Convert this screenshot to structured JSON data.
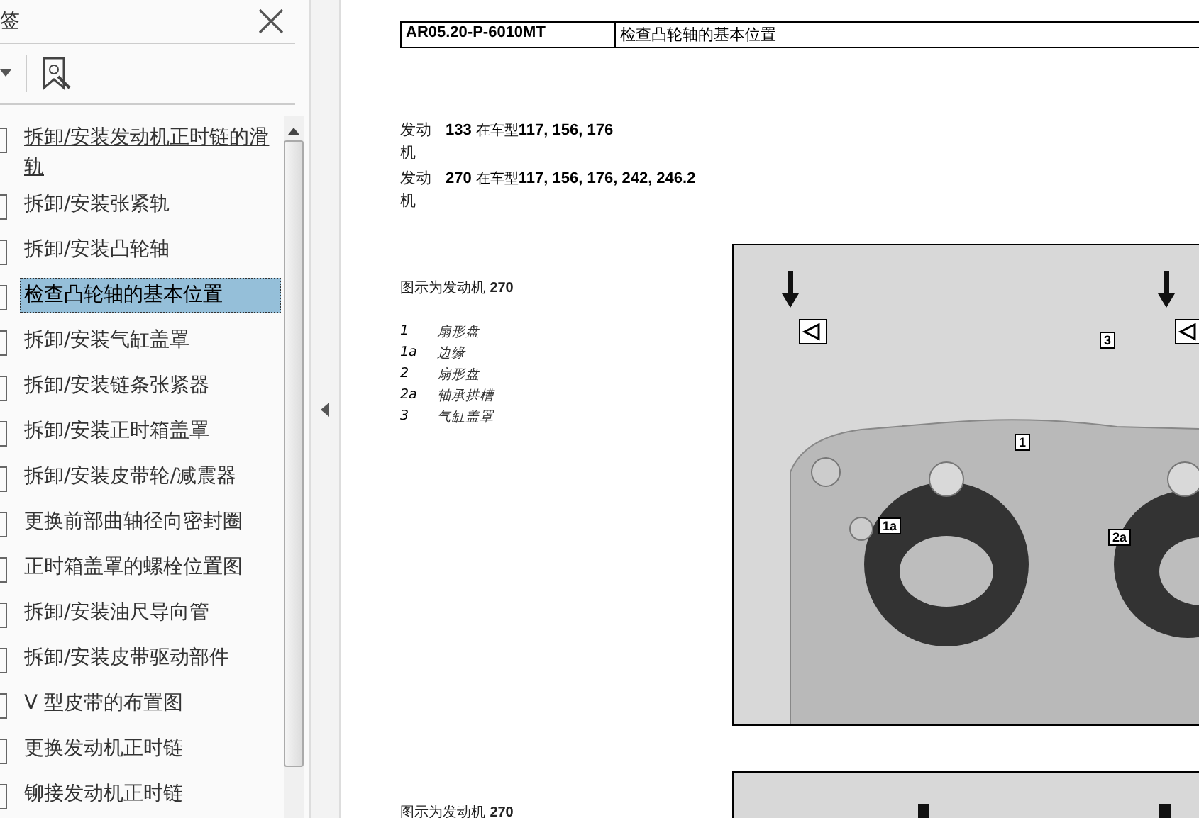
{
  "sidebar": {
    "title": "签",
    "items": [
      {
        "label": "拆卸/安装发动机正时链的滑轨",
        "selected": false,
        "hovered": true
      },
      {
        "label": "拆卸/安装张紧轨",
        "selected": false,
        "hovered": false
      },
      {
        "label": "拆卸/安装凸轮轴",
        "selected": false,
        "hovered": false
      },
      {
        "label": "检查凸轮轴的基本位置",
        "selected": true,
        "hovered": false
      },
      {
        "label": "拆卸/安装气缸盖罩",
        "selected": false,
        "hovered": false
      },
      {
        "label": "拆卸/安装链条张紧器",
        "selected": false,
        "hovered": false
      },
      {
        "label": "拆卸/安装正时箱盖罩",
        "selected": false,
        "hovered": false
      },
      {
        "label": "拆卸/安装皮带轮/减震器",
        "selected": false,
        "hovered": false
      },
      {
        "label": "更换前部曲轴径向密封圈",
        "selected": false,
        "hovered": false
      },
      {
        "label": "正时箱盖罩的螺栓位置图",
        "selected": false,
        "hovered": false
      },
      {
        "label": "拆卸/安装油尺导向管",
        "selected": false,
        "hovered": false
      },
      {
        "label": "拆卸/安装皮带驱动部件",
        "selected": false,
        "hovered": false
      },
      {
        "label": "V 型皮带的布置图",
        "selected": false,
        "hovered": false
      },
      {
        "label": "更换发动机正时链",
        "selected": false,
        "hovered": false
      },
      {
        "label": "铆接发动机正时链",
        "selected": false,
        "hovered": false
      }
    ]
  },
  "document": {
    "header": {
      "code": "AR05.20-P-6010MT",
      "title": "检查凸轮轴的基本位置"
    },
    "engines": [
      {
        "label": "发动机",
        "number": "133",
        "models_label": "在车型",
        "models": "117, 156, 176"
      },
      {
        "label": "发动机",
        "number": "270",
        "models_label": "在车型",
        "models": "117, 156, 176, 242, 246.2"
      }
    ],
    "figures": [
      {
        "caption": "图示为发动机",
        "engine": "270",
        "legend": [
          {
            "key": "1",
            "text": "扇形盘"
          },
          {
            "key": "1a",
            "text": "边缘"
          },
          {
            "key": "2",
            "text": "扇形盘"
          },
          {
            "key": "2a",
            "text": "轴承拱槽"
          },
          {
            "key": "3",
            "text": "气缸盖罩"
          }
        ],
        "callouts": [
          "1a",
          "1",
          "2a",
          "3"
        ]
      },
      {
        "caption": "图示为发动机",
        "engine": "270"
      }
    ]
  }
}
